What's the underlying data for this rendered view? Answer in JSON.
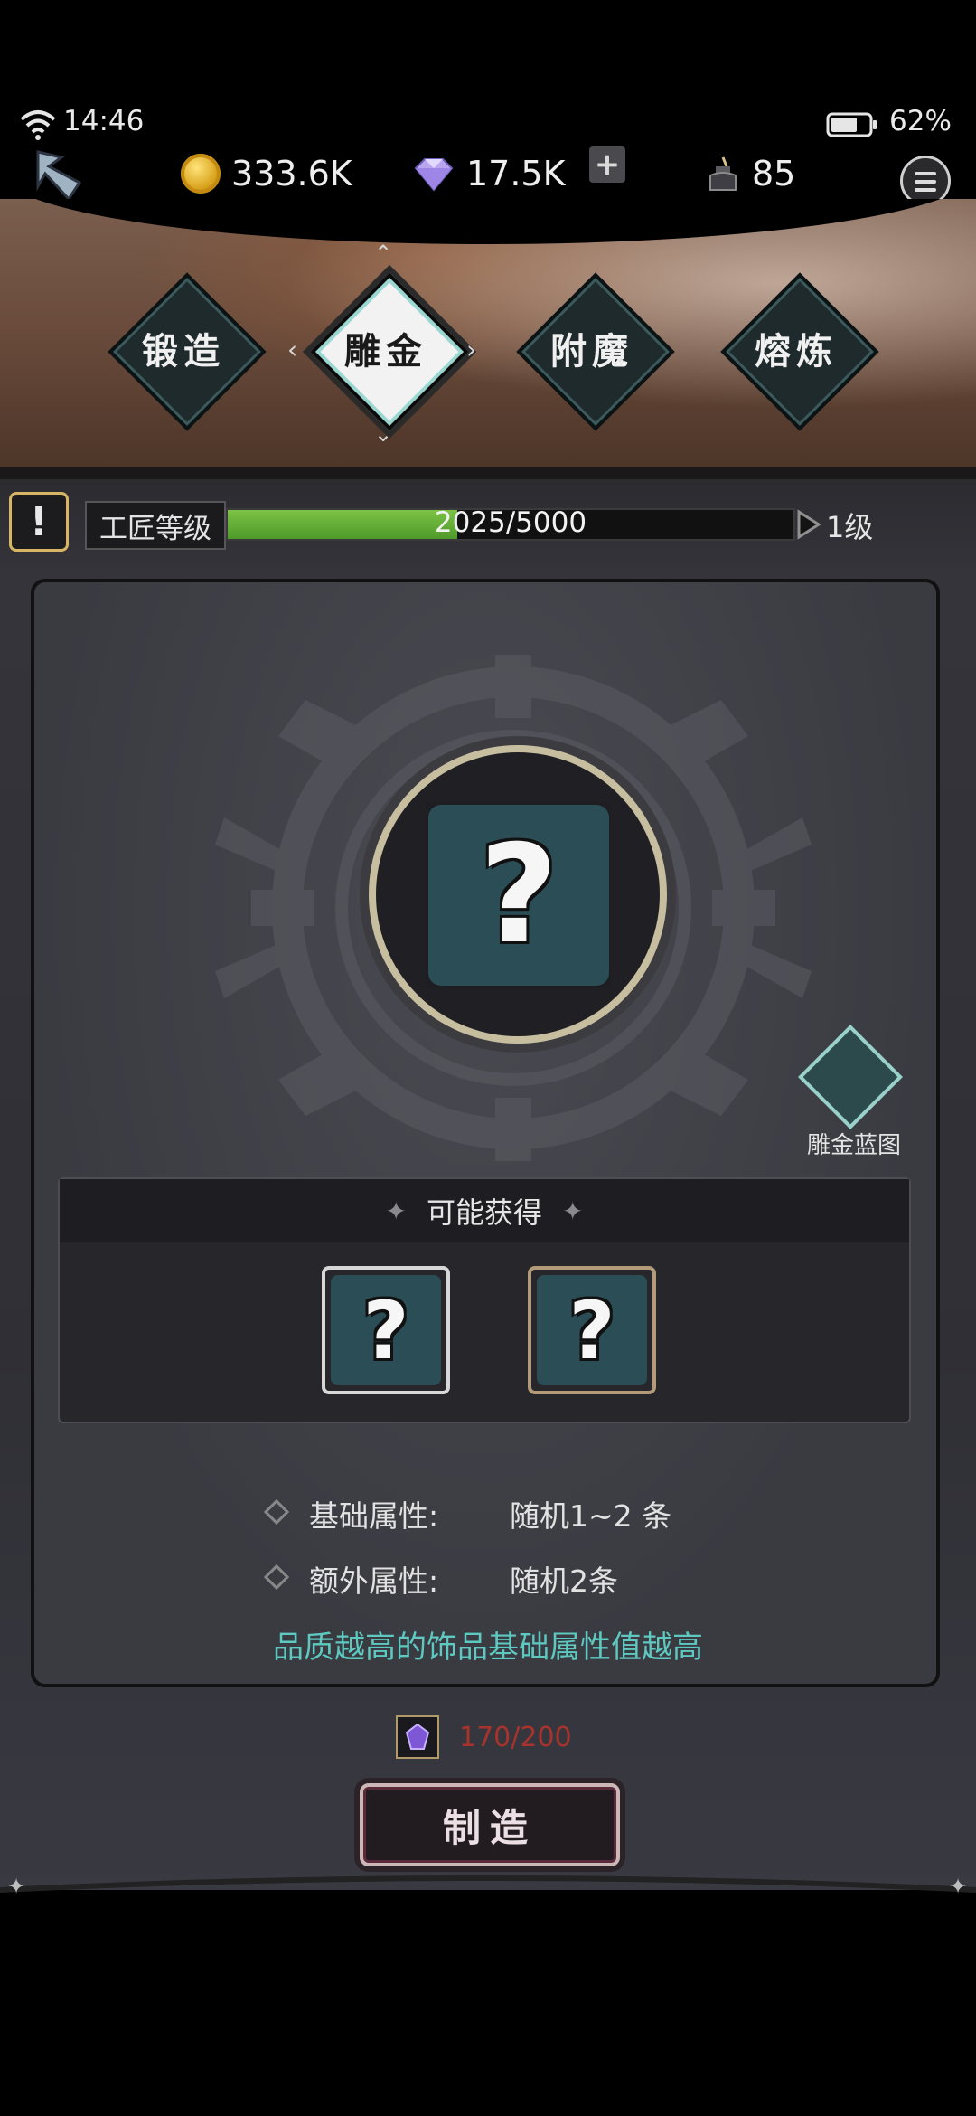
{
  "status_bar": {
    "time": "14:46",
    "battery": "62%"
  },
  "currencies": {
    "gold": "333.6K",
    "diamonds": "17.5K",
    "ink": "85"
  },
  "tabs": [
    {
      "label": "锻造"
    },
    {
      "label": "雕金"
    },
    {
      "label": "附魔"
    },
    {
      "label": "熔炼"
    }
  ],
  "active_tab": "雕金",
  "level": {
    "label": "工匠等级",
    "progress_text": "2025/5000",
    "progress_fraction": 0.405,
    "value": "1级"
  },
  "blueprint": {
    "label": "雕金蓝图"
  },
  "rewards": {
    "header": "可能获得"
  },
  "attributes": [
    {
      "key": "基础属性:",
      "value": "随机1~2 条"
    },
    {
      "key": "额外属性:",
      "value": "随机2条"
    }
  ],
  "hint": "品质越高的饰品基础属性值越高",
  "cost": {
    "text": "170/200"
  },
  "craft_button": "制造",
  "colors": {
    "accent_teal": "#5ec9c0",
    "xp_green": "#6cb33b",
    "cost_red": "#a8332d",
    "tab_dark": "#1f2a2c"
  }
}
